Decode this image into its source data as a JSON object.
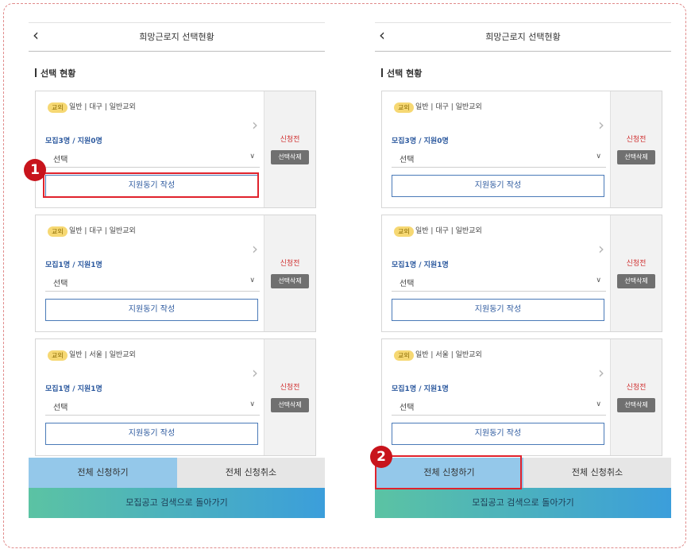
{
  "screens": [
    {
      "back_icon": "‹",
      "title": "희망근로지 선택현황",
      "section_title": "선택 현황",
      "cards": [
        {
          "badge": "교외",
          "categories": "일반 | 대구 | 일반교외",
          "recruit": "모집3명 / 지원0명",
          "select": "선택",
          "write_button": "지원동기 작성",
          "status": "신청전",
          "delete_button": "선택삭제"
        },
        {
          "badge": "교외",
          "categories": "일반 | 대구 | 일반교외",
          "recruit": "모집1명 / 지원1명",
          "select": "선택",
          "write_button": "지원동기 작성",
          "status": "신청전",
          "delete_button": "선택삭제"
        },
        {
          "badge": "교외",
          "categories": "일반 | 서울 | 일반교외",
          "recruit": "모집1명 / 지원1명",
          "select": "선택",
          "write_button": "지원동기 작성",
          "status": "신청전",
          "delete_button": "선택삭제"
        }
      ],
      "apply_all": "전체 신청하기",
      "cancel_all": "전체 신청취소",
      "back_to_search": "모집공고 검색으로 돌아가기",
      "step_number": "1"
    },
    {
      "back_icon": "‹",
      "title": "희망근로지 선택현황",
      "section_title": "선택 현황",
      "cards": [
        {
          "badge": "교외",
          "categories": "일반 | 대구 | 일반교외",
          "recruit": "모집3명 / 지원0명",
          "select": "선택",
          "write_button": "지원동기 작성",
          "status": "신청전",
          "delete_button": "선택삭제"
        },
        {
          "badge": "교외",
          "categories": "일반 | 대구 | 일반교외",
          "recruit": "모집1명 / 지원1명",
          "select": "선택",
          "write_button": "지원동기 작성",
          "status": "신청전",
          "delete_button": "선택삭제"
        },
        {
          "badge": "교외",
          "categories": "일반 | 서울 | 일반교외",
          "recruit": "모집1명 / 지원1명",
          "select": "선택",
          "write_button": "지원동기 작성",
          "status": "신청전",
          "delete_button": "선택삭제"
        }
      ],
      "apply_all": "전체 신청하기",
      "cancel_all": "전체 신청취소",
      "back_to_search": "모집공고 검색으로 돌아가기",
      "step_number": "2"
    }
  ],
  "icons": {
    "chevron_right": "›",
    "chevron_down": "∨"
  },
  "colors": {
    "highlight": "#e0222c",
    "step_badge": "#c8141c",
    "apply_all_bg": "#94c8ea",
    "status_red": "#d03030",
    "link_blue": "#2d5a9f"
  }
}
